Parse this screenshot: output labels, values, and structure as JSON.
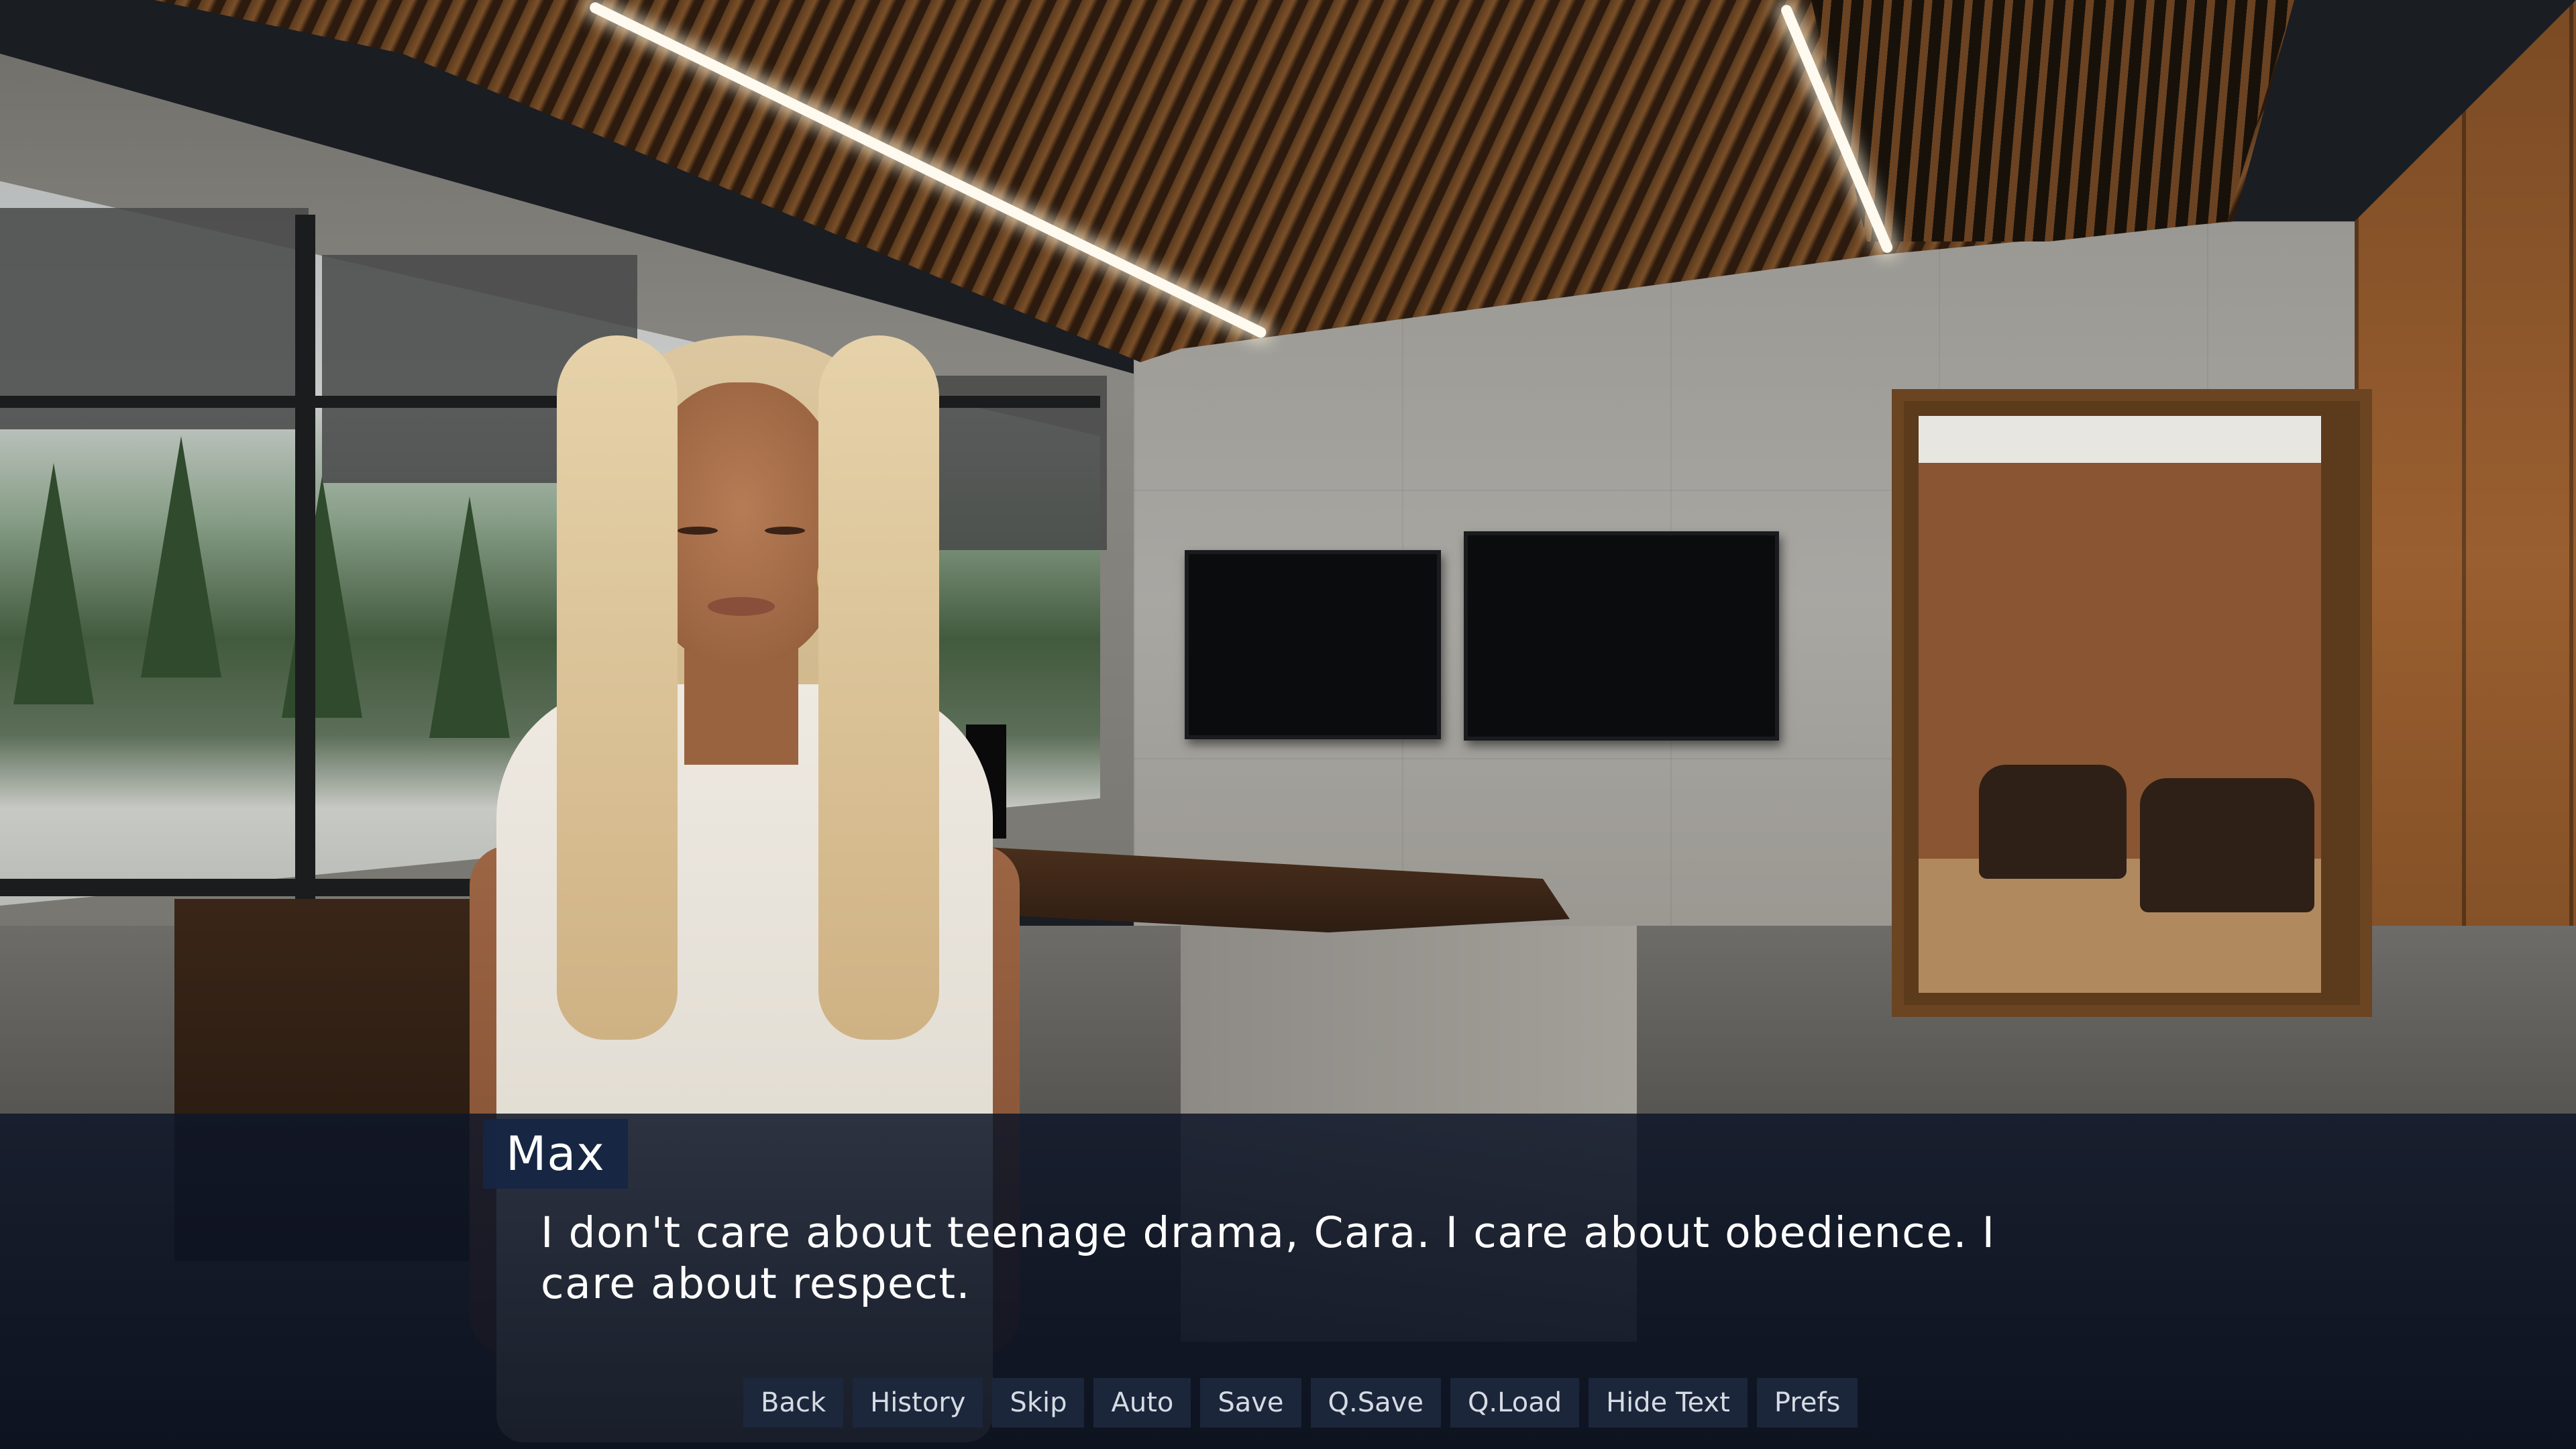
{
  "speaker": {
    "name": "Max"
  },
  "dialogue": {
    "text": "I don't care about teenage drama, Cara. I care about obedience. I care about respect."
  },
  "quick_menu": {
    "items": [
      {
        "label": "Back",
        "icon": "none"
      },
      {
        "label": "History",
        "icon": "none"
      },
      {
        "label": "Skip",
        "icon": "none"
      },
      {
        "label": "Auto",
        "icon": "none"
      },
      {
        "label": "Save",
        "icon": "none"
      },
      {
        "label": "Q.Save",
        "icon": "none"
      },
      {
        "label": "Q.Load",
        "icon": "none"
      },
      {
        "label": "Hide Text",
        "icon": "none"
      },
      {
        "label": "Prefs",
        "icon": "none"
      }
    ]
  },
  "colors": {
    "textbox_bg": "#0e1628",
    "namebox_bg": "#162642",
    "text": "#ffffff",
    "button_text": "#d6dbe3"
  }
}
